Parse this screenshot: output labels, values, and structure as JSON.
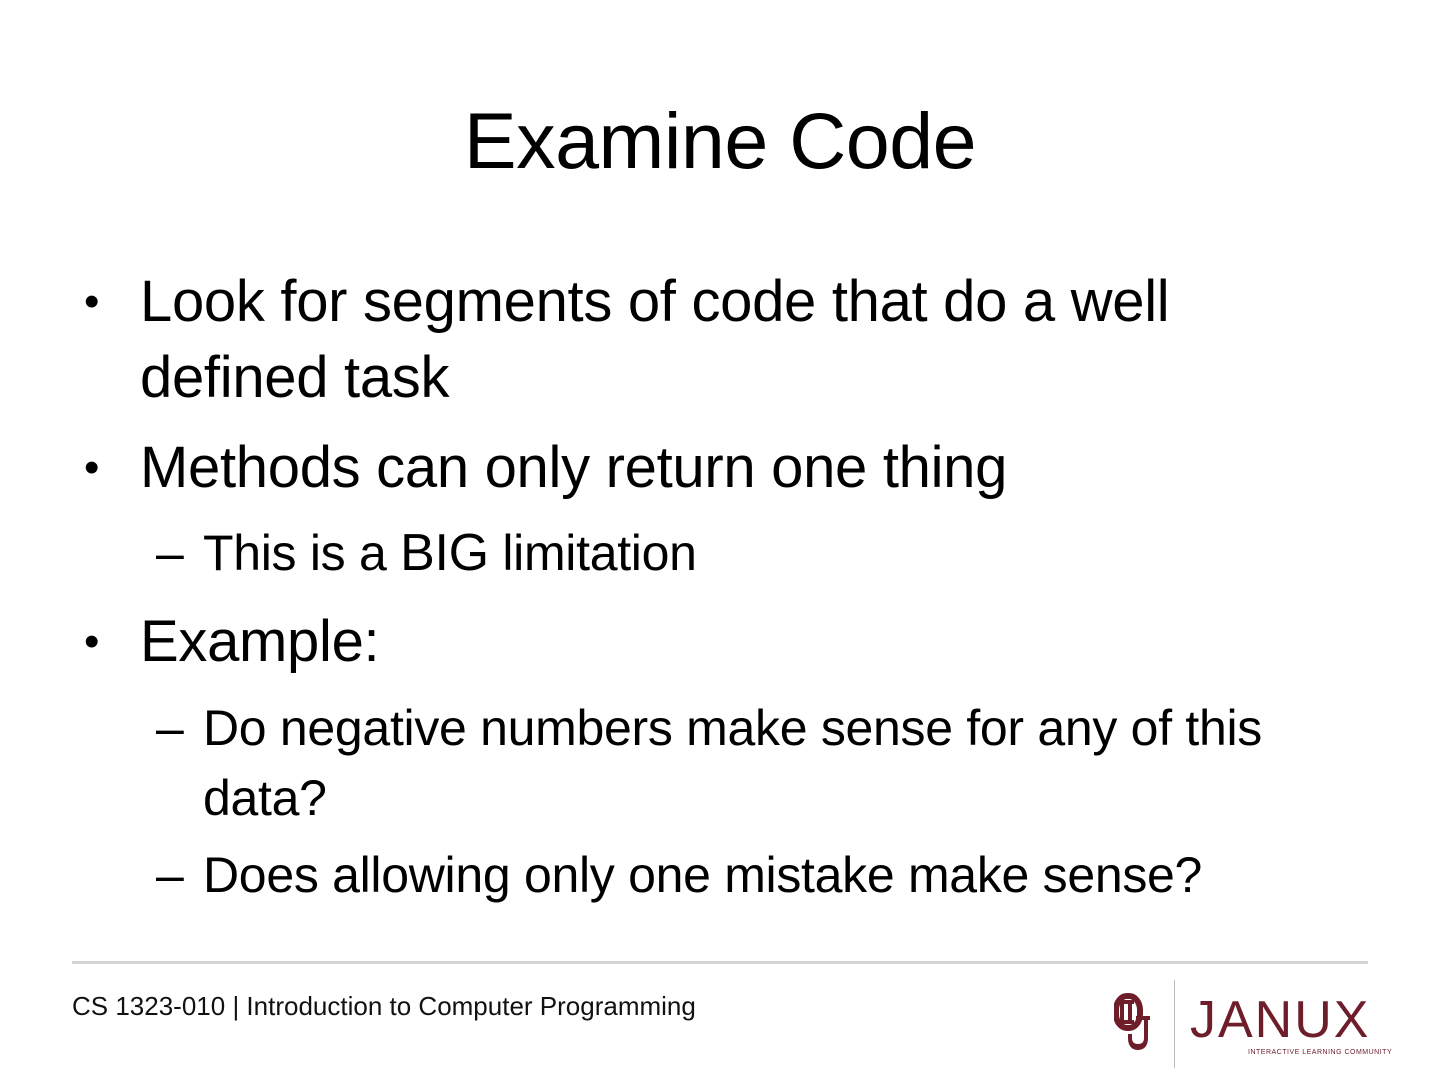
{
  "slide": {
    "title": "Examine Code",
    "bullets": [
      {
        "marker": "•",
        "text": "Look for segments of code that do a well defined task"
      },
      {
        "marker": "•",
        "text": "Methods can only return one thing",
        "sub": [
          {
            "marker": "–",
            "text_before": "This is a ",
            "emphasis": "BIG",
            "text_after": " limitation"
          }
        ]
      },
      {
        "marker": "•",
        "text": "Example:",
        "sub": [
          {
            "marker": "–",
            "text": "Do negative numbers make sense for any of this data?"
          },
          {
            "marker": "–",
            "text": "Does allowing only one mistake make sense?"
          }
        ]
      }
    ]
  },
  "footer": {
    "course": "CS 1323-010 | Introduction to Computer Programming",
    "logo_ou_name": "ou-logo-icon",
    "janux_wordmark": "JANUX",
    "janux_tagline": "INTERACTIVE LEARNING COMMUNITY"
  },
  "colors": {
    "text": "#000000",
    "rule": "#d4d4d4",
    "brand_crimson": "#6e1e2a"
  }
}
